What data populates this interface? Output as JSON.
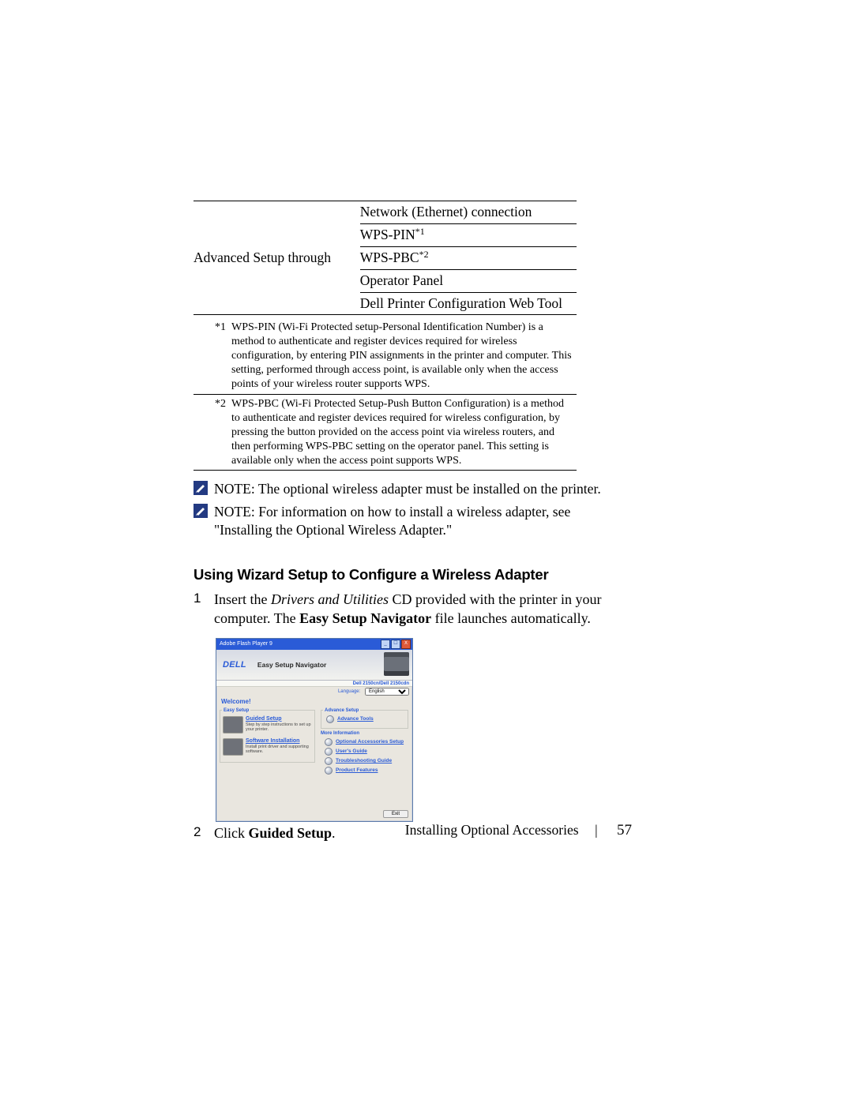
{
  "setup_table": {
    "col1_label": "Advanced Setup through",
    "rows": [
      "Network (Ethernet) connection",
      "WPS-PIN",
      "WPS-PBC",
      "Operator Panel",
      "Dell Printer Configuration Web Tool"
    ],
    "sup1": "*1",
    "sup2": "*2"
  },
  "footnotes": {
    "fn1_label": "*1",
    "fn1_text": "WPS-PIN (Wi-Fi Protected setup-Personal Identification Number) is a method to authenticate and register devices required for wireless configuration, by entering PIN assignments in the printer and computer. This setting, performed through access point, is available only when the access points of your wireless router supports WPS.",
    "fn2_label": "*2",
    "fn2_text": "WPS-PBC (Wi-Fi Protected Setup-Push Button Configuration) is a method to authenticate and register devices required for wireless configuration, by pressing the button provided on the access point via wireless routers, and then performing WPS-PBC setting on the operator panel. This setting is available only when the access point supports WPS."
  },
  "notes": {
    "note1": "NOTE: The optional wireless adapter must be installed on the printer.",
    "note2": "NOTE: For information on how to install a wireless adapter, see \"Installing the Optional Wireless Adapter.\""
  },
  "section_heading": "Using Wizard Setup to Configure a Wireless Adapter",
  "steps": {
    "s1_num": "1",
    "s1_pre": "Insert the ",
    "s1_italic": "Drivers and Utilities",
    "s1_mid": " CD provided with the printer in your computer. The ",
    "s1_bold": "Easy Setup Navigator",
    "s1_post": " file launches automatically.",
    "s2_num": "2",
    "s2_pre": "Click ",
    "s2_bold": "Guided Setup",
    "s2_post": "."
  },
  "navigator": {
    "titlebar": "Adobe Flash Player 9",
    "dell": "DELL",
    "title": "Easy Setup Navigator",
    "model": "Dell 2150cn/Dell 2150cdn",
    "language_label": "Language:",
    "language_value": "English",
    "welcome": "Welcome!",
    "easy_setup_legend": "Easy Setup",
    "guided_setup": "Guided Setup",
    "guided_setup_desc": "Step by step instructions to set up your printer.",
    "software_installation": "Software Installation",
    "software_installation_desc": "Install print driver and supporting software.",
    "advance_setup_legend": "Advance Setup",
    "advance_tools": "Advance Tools",
    "more_info_legend": "More Information",
    "optional_accessories": "Optional Accessories Setup",
    "users_guide": "User's Guide",
    "troubleshooting_guide": "Troubleshooting Guide",
    "product_features": "Product Features",
    "exit": "Exit"
  },
  "footer": {
    "section": "Installing Optional Accessories",
    "page": "57"
  }
}
